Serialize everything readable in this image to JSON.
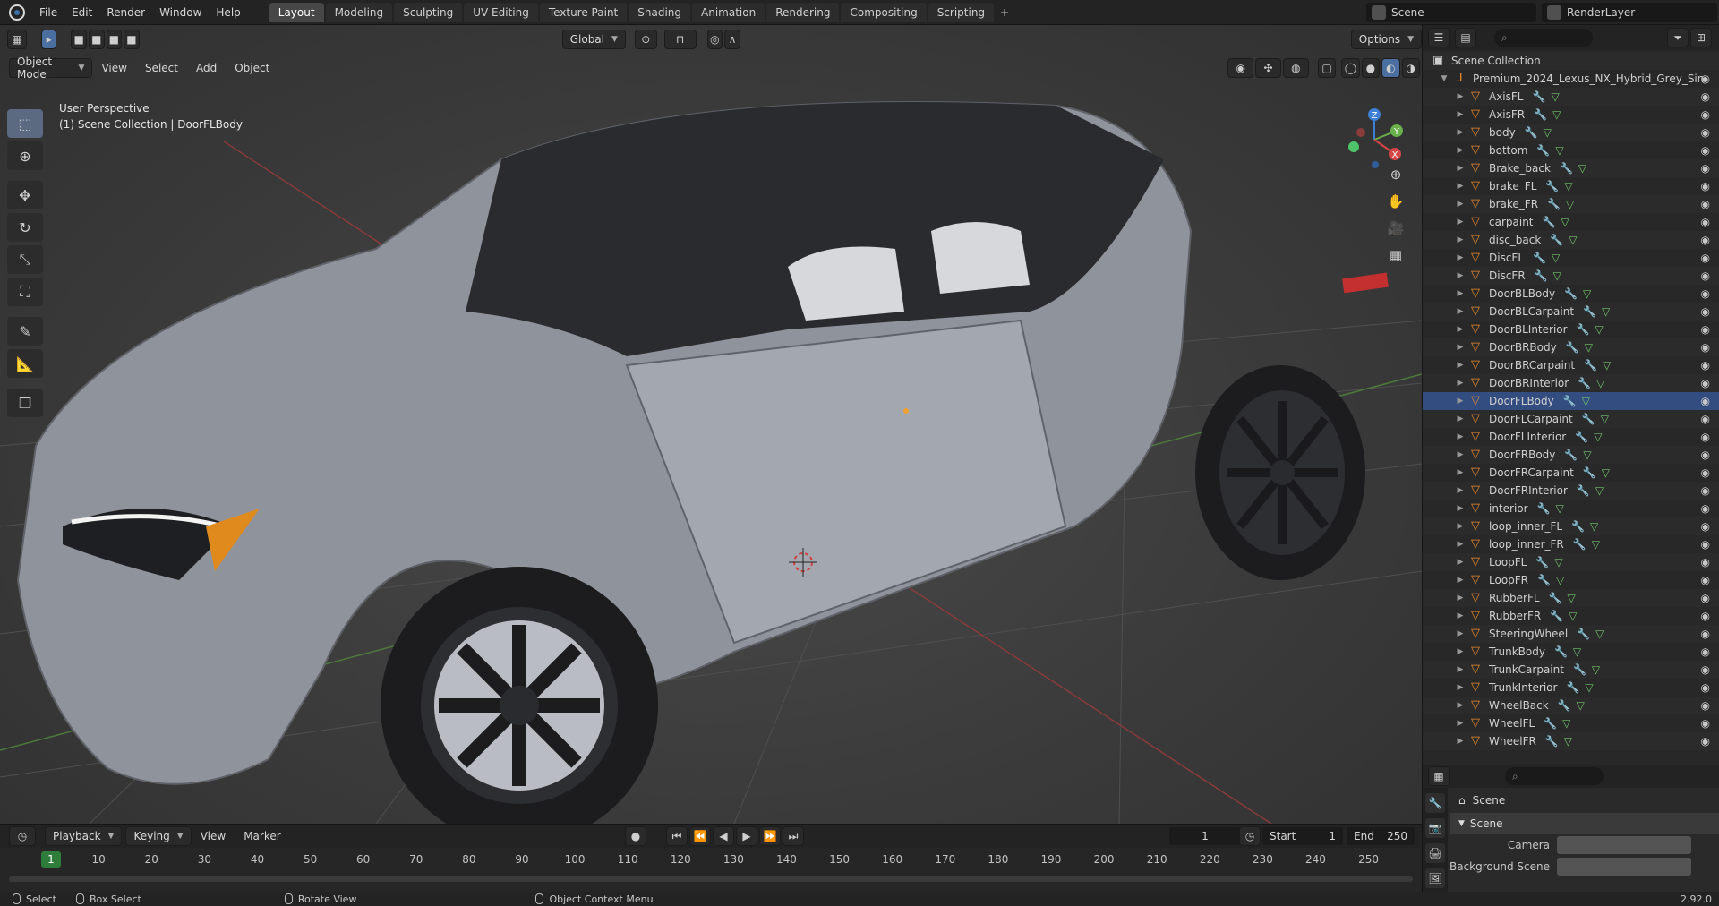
{
  "menubar": {
    "items": [
      "File",
      "Edit",
      "Render",
      "Window",
      "Help"
    ],
    "workspaces": [
      "Layout",
      "Modeling",
      "Sculpting",
      "UV Editing",
      "Texture Paint",
      "Shading",
      "Animation",
      "Rendering",
      "Compositing",
      "Scripting"
    ],
    "active_workspace": "Layout",
    "scene": "Scene",
    "render_layer": "RenderLayer"
  },
  "viewport": {
    "mode": "Object Mode",
    "menu": [
      "View",
      "Select",
      "Add",
      "Object"
    ],
    "transform_orientation": "Global",
    "options_label": "Options",
    "overlay_line1": "User Perspective",
    "overlay_line2": "(1) Scene Collection | DoorFLBody",
    "gizmo_axes": [
      "X",
      "Y",
      "Z"
    ]
  },
  "outliner": {
    "root": "Scene Collection",
    "collection": "Premium_2024_Lexus_NX_Hybrid_Grey_Sin",
    "selected": "DoorFLBody",
    "objects": [
      "AxisFL",
      "AxisFR",
      "body",
      "bottom",
      "Brake_back",
      "brake_FL",
      "brake_FR",
      "carpaint",
      "disc_back",
      "DiscFL",
      "DiscFR",
      "DoorBLBody",
      "DoorBLCarpaint",
      "DoorBLInterior",
      "DoorBRBody",
      "DoorBRCarpaint",
      "DoorBRInterior",
      "DoorFLBody",
      "DoorFLCarpaint",
      "DoorFLInterior",
      "DoorFRBody",
      "DoorFRCarpaint",
      "DoorFRInterior",
      "interior",
      "loop_inner_FL",
      "loop_inner_FR",
      "LoopFL",
      "LoopFR",
      "RubberFL",
      "RubberFR",
      "SteeringWheel",
      "TrunkBody",
      "TrunkCarpaint",
      "TrunkInterior",
      "WheelBack",
      "WheelFL",
      "WheelFR"
    ]
  },
  "properties": {
    "context": "Scene",
    "panel": "Scene",
    "fields": [
      "Camera",
      "Background Scene"
    ]
  },
  "timeline": {
    "menu": [
      "Playback",
      "Keying",
      "View",
      "Marker"
    ],
    "current_frame": "1",
    "start_label": "Start",
    "start_value": "1",
    "end_label": "End",
    "end_value": "250",
    "ticks": [
      "10",
      "20",
      "30",
      "40",
      "50",
      "60",
      "70",
      "80",
      "90",
      "100",
      "110",
      "120",
      "130",
      "140",
      "150",
      "160",
      "170",
      "180",
      "190",
      "200",
      "210",
      "220",
      "230",
      "240",
      "250"
    ]
  },
  "statusbar": {
    "select": "Select",
    "box_select": "Box Select",
    "rotate_view": "Rotate View",
    "context_menu": "Object Context Menu",
    "version": "2.92.0"
  },
  "colors": {
    "selection": "#334d80",
    "object_icon": "#e8892d",
    "active_frame": "#2f7d3b",
    "car_body": "#8f949c"
  }
}
